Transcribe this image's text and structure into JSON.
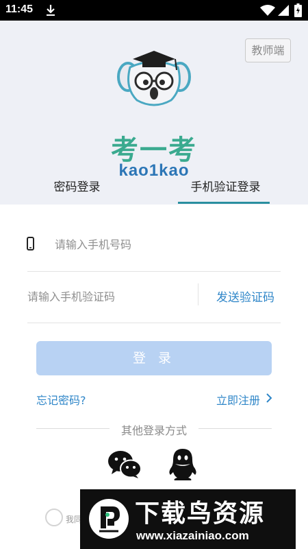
{
  "status_bar": {
    "time": "11:45"
  },
  "header": {
    "teacher_button": "教师端",
    "logo_title": "考一考",
    "logo_subtitle": "kao1kao"
  },
  "tabs": [
    {
      "label": "密码登录",
      "active": false
    },
    {
      "label": "手机验证登录",
      "active": true
    }
  ],
  "form": {
    "phone_placeholder": "请输入手机号码",
    "phone_value": "",
    "code_placeholder": "请输入手机验证码",
    "code_value": "",
    "send_code_label": "发送验证码",
    "login_label": "登 录",
    "forgot_label": "忘记密码?",
    "register_label": "立即注册"
  },
  "other_login": {
    "label": "其他登录方式",
    "providers": [
      "wechat-icon",
      "qq-icon"
    ]
  },
  "agreement": {
    "text": "我同"
  },
  "watermark": {
    "title": "下载鸟资源",
    "url": "www.xiazainiao.com"
  },
  "colors": {
    "accent": "#2f86c8",
    "tab_underline": "#2a8fa0",
    "logo_green": "#3aaa8f",
    "logo_blue": "#2c76b6",
    "login_button": "#b8d2f3",
    "header_bg": "#eef0f6"
  }
}
